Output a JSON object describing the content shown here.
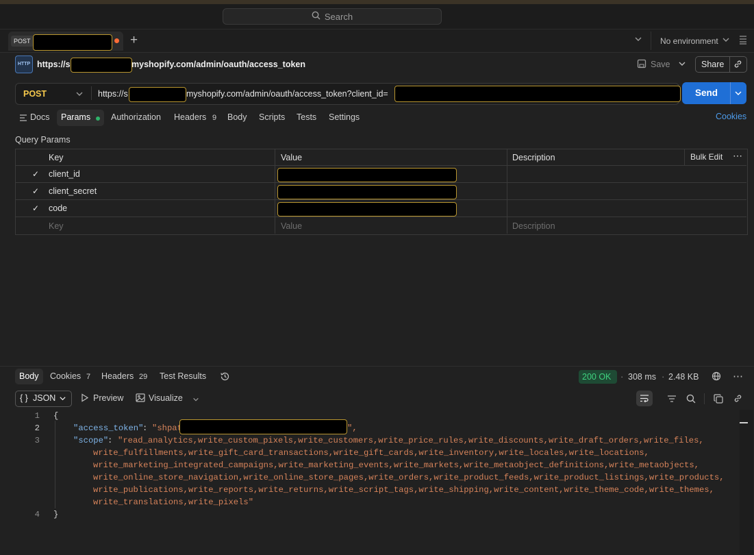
{
  "search": {
    "placeholder": "Search"
  },
  "tab": {
    "method": "POST"
  },
  "env": {
    "selected": "No environment"
  },
  "request": {
    "title_prefix": "https://s",
    "title_suffix": "myshopify.com/admin/oauth/access_token",
    "save_label": "Save",
    "share_label": "Share",
    "http_icon_text": "HTTP",
    "method": "POST",
    "url_prefix": "https://s",
    "url_suffix": "myshopify.com/admin/oauth/access_token?client_id=",
    "send_label": "Send"
  },
  "subtabs": {
    "docs": "Docs",
    "params": "Params",
    "authorization": "Authorization",
    "headers": "Headers",
    "headers_count": "9",
    "body": "Body",
    "scripts": "Scripts",
    "tests": "Tests",
    "settings": "Settings",
    "cookies": "Cookies"
  },
  "query_params": {
    "title": "Query Params",
    "columns": {
      "key": "Key",
      "value": "Value",
      "description": "Description"
    },
    "bulk_edit": "Bulk Edit",
    "rows": [
      {
        "key": "client_id"
      },
      {
        "key": "client_secret"
      },
      {
        "key": "code"
      }
    ],
    "placeholder": {
      "key": "Key",
      "value": "Value",
      "description": "Description"
    }
  },
  "response": {
    "tabs": {
      "body": "Body",
      "cookies": "Cookies",
      "cookies_count": "7",
      "headers": "Headers",
      "headers_count": "29",
      "test_results": "Test Results"
    },
    "status": "200 OK",
    "time": "308 ms",
    "size": "2.48 KB",
    "format": "JSON",
    "format_braces": "{ }",
    "preview": "Preview",
    "visualize": "Visualize"
  },
  "code": {
    "lines": [
      "1",
      "2",
      "3",
      "4"
    ],
    "open_brace": "{",
    "close_brace": "}",
    "token_key": "\"access_token\"",
    "token_colon": ": ",
    "token_prefix": "\"shpat",
    "token_end": "\",",
    "scope_key": "\"scope\"",
    "scope_colon": ": ",
    "scope_lines": [
      "\"read_analytics,write_custom_pixels,write_customers,write_price_rules,write_discounts,write_draft_orders,write_files,",
      "write_fulfillments,write_gift_card_transactions,write_gift_cards,write_inventory,write_locales,write_locations,",
      "write_marketing_integrated_campaigns,write_marketing_events,write_markets,write_metaobject_definitions,write_metaobjects,",
      "write_online_store_navigation,write_online_store_pages,write_orders,write_product_feeds,write_product_listings,write_products,",
      "write_publications,write_reports,write_returns,write_script_tags,write_shipping,write_content,write_theme_code,write_themes,",
      "write_translations,write_pixels\""
    ]
  }
}
